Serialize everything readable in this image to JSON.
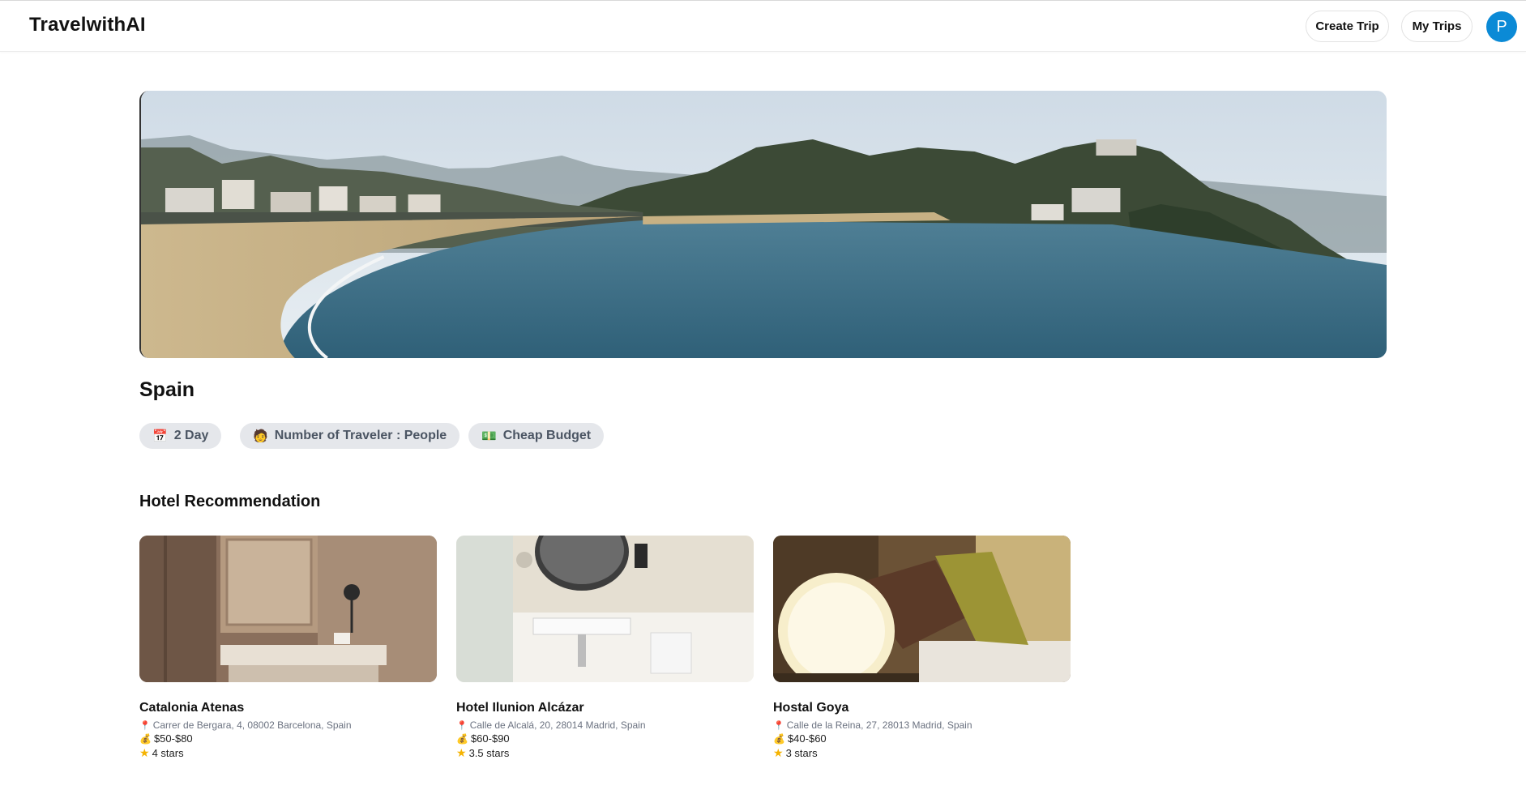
{
  "header": {
    "logo": "TravelwithAI",
    "create_trip": "Create Trip",
    "my_trips": "My Trips",
    "avatar_initial": "P"
  },
  "trip": {
    "destination": "Spain",
    "chips": {
      "days_icon": "calendar-icon",
      "days": "2 Day",
      "travelers_icon": "person-icon",
      "travelers": "Number of Traveler : People",
      "budget_icon": "money-icon",
      "budget": "Cheap Budget"
    }
  },
  "hotels": {
    "title": "Hotel Recommendation",
    "items": [
      {
        "name": "Catalonia Atenas",
        "address": "Carrer de Bergara, 4, 08002 Barcelona, Spain",
        "price": "$50-$80",
        "rating": "4 stars"
      },
      {
        "name": "Hotel Ilunion Alcázar",
        "address": "Calle de Alcalá, 20, 28014 Madrid, Spain",
        "price": "$60-$90",
        "rating": "3.5 stars"
      },
      {
        "name": "Hostal Goya",
        "address": "Calle de la Reina, 27, 28013 Madrid, Spain",
        "price": "$40-$60",
        "rating": "3 stars"
      }
    ]
  },
  "colors": {
    "accent": "#0b8ad6",
    "chip_bg": "#e5e7eb",
    "chip_text": "#4b5563"
  }
}
